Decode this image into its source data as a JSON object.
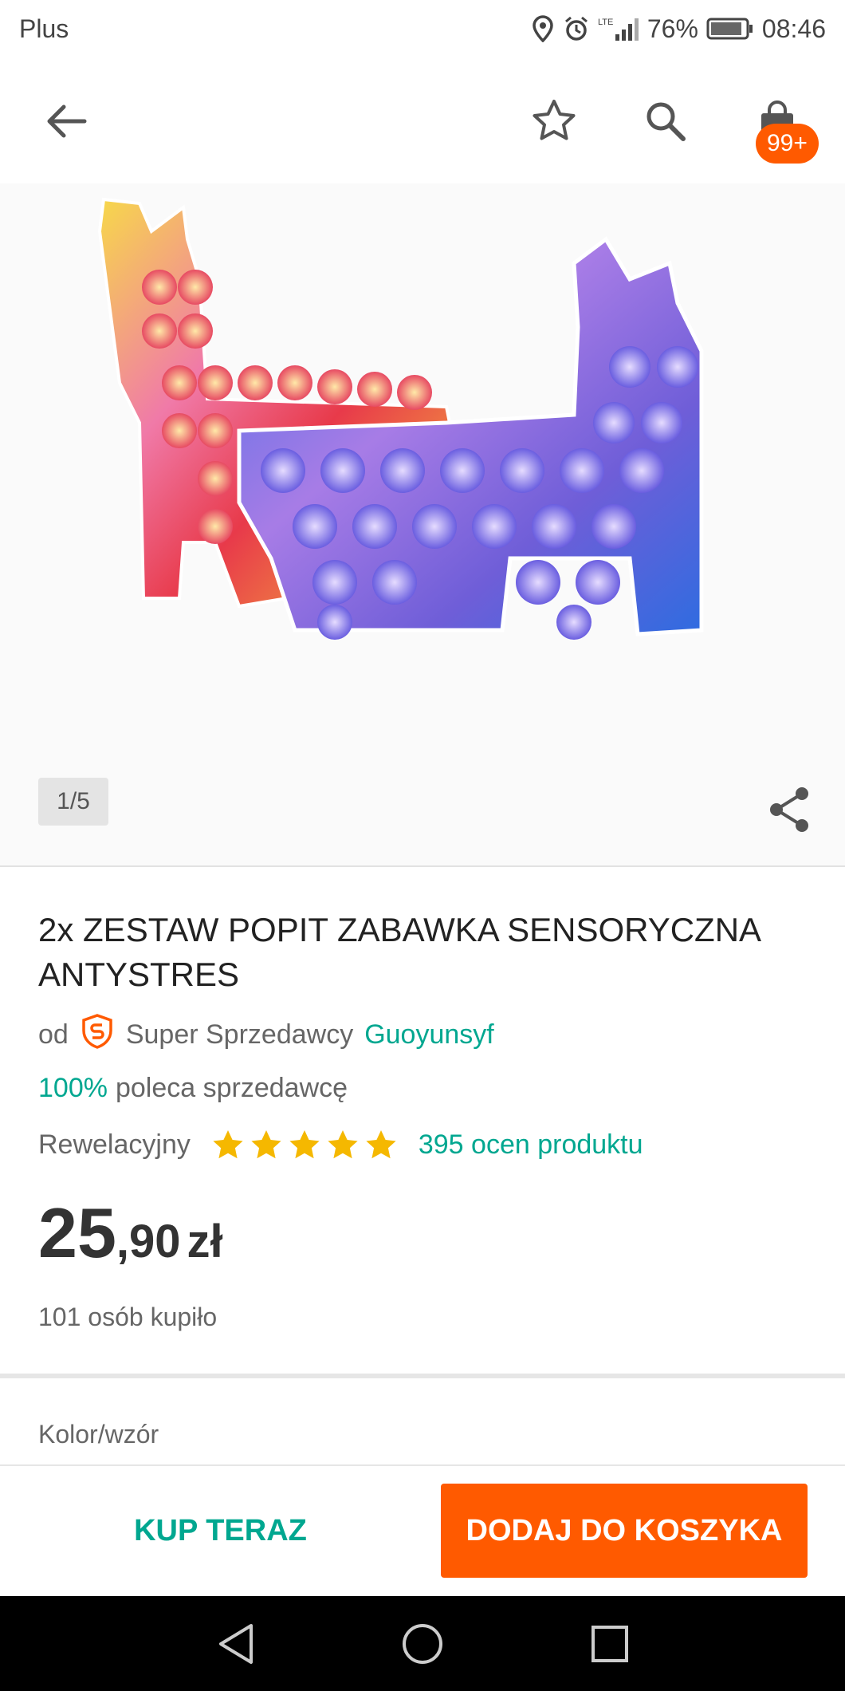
{
  "status_bar": {
    "carrier": "Plus",
    "network": "LTE",
    "battery": "76%",
    "time": "08:46"
  },
  "header": {
    "icons": [
      "back-arrow-icon",
      "star-icon",
      "search-icon",
      "shopping-bag-icon"
    ],
    "cart_badge": "99+"
  },
  "gallery": {
    "counter": "1/5",
    "share_icon": "share-icon"
  },
  "product": {
    "title": "2x ZESTAW POPIT ZABAWKA SENSORYCZNA ANTYSTRES",
    "seller_prefix": "od",
    "seller_badge": "Super Sprzedawcy",
    "seller_name": "Guoyunsyf",
    "recommend_pct": "100%",
    "recommend_text": "poleca sprzedawcę",
    "rating_label": "Rewelacyjny",
    "rating_stars": 5,
    "rating_count": "395 ocen produktu",
    "price_int": "25",
    "price_dec": ",90",
    "price_currency": "zł",
    "bought": "101 osób kupiło",
    "variant_label": "Kolor/wzór"
  },
  "actions": {
    "buy_now": "KUP TERAZ",
    "add_to_cart": "DODAJ DO KOSZYKA"
  },
  "colors": {
    "accent_green": "#00a790",
    "accent_orange": "#ff5a00",
    "star_yellow": "#f5b800"
  }
}
